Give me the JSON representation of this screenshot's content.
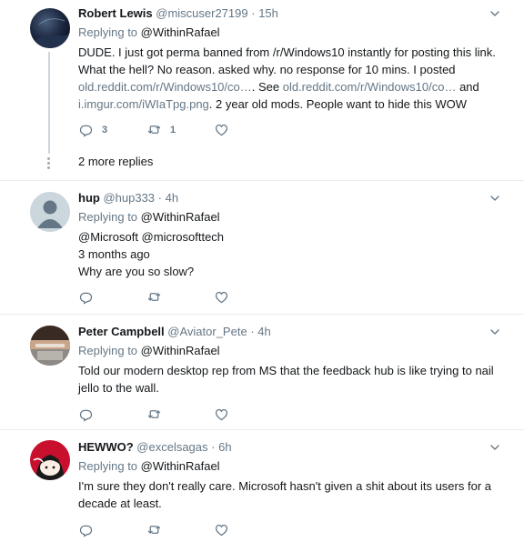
{
  "tweets": [
    {
      "name": "Robert Lewis",
      "handle": "@miscuser27199",
      "time": "15h",
      "replying_label": "Replying to",
      "replying_to": "@WithinRafael",
      "text": {
        "p1": "DUDE. I just got perma banned from /r/Windows10 instantly for posting this link. What the hell? No reason. asked why. no response for 10 mins.  I posted ",
        "link1": "old.reddit.com/r/Windows10/co…",
        "p2": ". See ",
        "link2": "old.reddit.com/r/Windows10/co…",
        "p3": " and ",
        "link3": "i.imgur.com/iWIaTpg.png",
        "p4": ". 2 year old mods. People want to hide this WOW"
      },
      "reply_count": "3",
      "retweet_count": "1",
      "more_replies": "2 more replies"
    },
    {
      "name": "hup",
      "handle": "@hup333",
      "time": "4h",
      "replying_label": "Replying to",
      "replying_to": "@WithinRafael",
      "lines": [
        "@Microsoft @microsofttech",
        "3 months ago",
        "Why are you so slow?"
      ]
    },
    {
      "name": "Peter Campbell",
      "handle": "@Aviator_Pete",
      "time": "4h",
      "replying_label": "Replying to",
      "replying_to": "@WithinRafael",
      "text": "Told our modern desktop rep from MS that the feedback hub is like trying to nail jello to the wall."
    },
    {
      "name": "HEWWO?",
      "handle": "@excelsagas",
      "time": "6h",
      "replying_label": "Replying to",
      "replying_to": "@WithinRafael",
      "text": "I'm sure they don't really care. Microsoft hasn't given a shit about its users for a decade at least."
    }
  ],
  "icons": {
    "reply": "reply-icon",
    "retweet": "retweet-icon",
    "like": "heart-icon",
    "menu": "chevron-down-icon"
  },
  "colors": {
    "secondary_text": "#657786",
    "divider": "#e6ecf0",
    "thread_line": "#ccd6dd"
  }
}
